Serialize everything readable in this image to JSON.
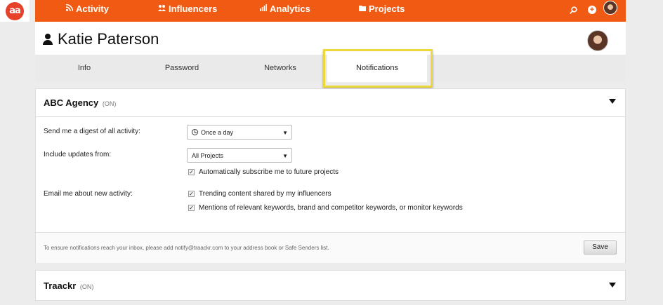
{
  "brand": {
    "logo_text": "aa",
    "accent": "#f15a12"
  },
  "nav": {
    "items": [
      {
        "label": "Activity",
        "icon": "rss-icon"
      },
      {
        "label": "Influencers",
        "icon": "people-icon"
      },
      {
        "label": "Analytics",
        "icon": "bar-chart-icon"
      },
      {
        "label": "Projects",
        "icon": "folder-icon"
      }
    ]
  },
  "profile": {
    "name": "Katie Paterson"
  },
  "tabs": [
    {
      "label": "Info"
    },
    {
      "label": "Password"
    },
    {
      "label": "Networks"
    },
    {
      "label": "Notifications",
      "active": true
    }
  ],
  "sections": {
    "abc": {
      "title": "ABC Agency",
      "status": "(ON)",
      "digest_label": "Send me a digest of all activity:",
      "digest_value": "Once a day",
      "updates_label": "Include updates from:",
      "updates_value": "All Projects",
      "auto_subscribe": "Automatically subscribe me to future projects",
      "email_label": "Email me about new activity:",
      "email_options": [
        "Trending content shared by my influencers",
        "Mentions of relevant keywords, brand and competitor keywords, or monitor keywords"
      ],
      "footer_note": "To ensure notifications reach your inbox, please add notify@traackr.com to your address book or Safe Senders list.",
      "save_label": "Save"
    },
    "traackr": {
      "title": "Traackr",
      "status": "(ON)"
    }
  }
}
